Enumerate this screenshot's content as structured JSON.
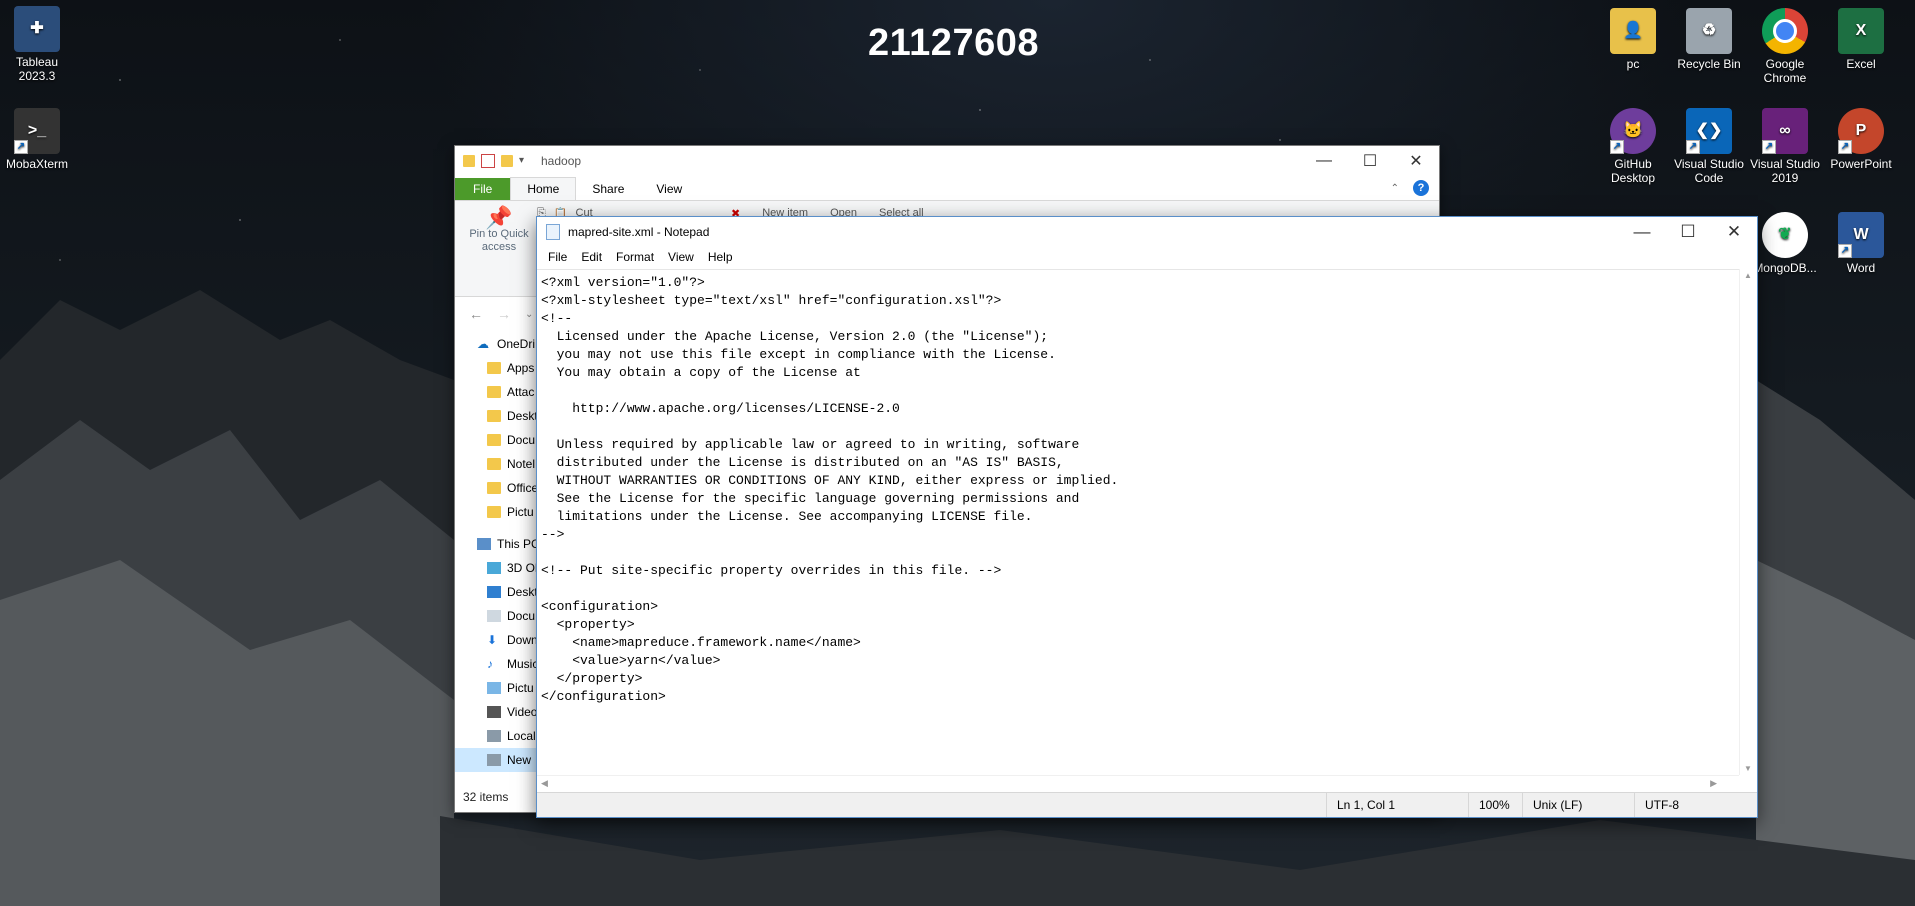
{
  "desktop": {
    "number": "21127608",
    "icons_left": [
      {
        "label": "Tableau 2023.3",
        "icon": "tableau-icon"
      },
      {
        "label": "MobaXterm",
        "icon": "mobaxterm-icon"
      }
    ],
    "icons_right": [
      {
        "label": "pc",
        "icon": "user-folder-icon"
      },
      {
        "label": "Recycle Bin",
        "icon": "recycle-bin-icon"
      },
      {
        "label": "Google Chrome",
        "icon": "chrome-icon"
      },
      {
        "label": "Excel",
        "icon": "excel-icon"
      },
      {
        "label": "GitHub Desktop",
        "icon": "github-icon"
      },
      {
        "label": "Visual Studio Code",
        "icon": "vscode-icon"
      },
      {
        "label": "Visual Studio 2019",
        "icon": "visual-studio-icon"
      },
      {
        "label": "PowerPoint",
        "icon": "powerpoint-icon"
      },
      {
        "label": "MongoDB...",
        "icon": "mongodb-icon"
      },
      {
        "label": "Word",
        "icon": "word-icon"
      }
    ]
  },
  "explorer": {
    "title": "hadoop",
    "tabs": [
      "File",
      "Home",
      "Share",
      "View"
    ],
    "ribbon": {
      "pin_label": "Pin to Quick access",
      "cut": "Cut",
      "new_item": "New item",
      "open": "Open",
      "select_all": "Select all"
    },
    "nav_items": [
      "OneDri",
      "Apps",
      "Attac",
      "Deskt",
      "Docu",
      "Notel",
      "Office",
      "Pictu",
      "This PC",
      "3D Ol",
      "Deskt",
      "Docu",
      "Down",
      "Music",
      "Pictu",
      "Video",
      "Local",
      "New"
    ],
    "status": "32 items"
  },
  "notepad": {
    "title": "mapred-site.xml - Notepad",
    "menu": [
      "File",
      "Edit",
      "Format",
      "View",
      "Help"
    ],
    "content": "<?xml version=\"1.0\"?>\n<?xml-stylesheet type=\"text/xsl\" href=\"configuration.xsl\"?>\n<!--\n  Licensed under the Apache License, Version 2.0 (the \"License\");\n  you may not use this file except in compliance with the License.\n  You may obtain a copy of the License at\n\n    http://www.apache.org/licenses/LICENSE-2.0\n\n  Unless required by applicable law or agreed to in writing, software\n  distributed under the License is distributed on an \"AS IS\" BASIS,\n  WITHOUT WARRANTIES OR CONDITIONS OF ANY KIND, either express or implied.\n  See the License for the specific language governing permissions and\n  limitations under the License. See accompanying LICENSE file.\n-->\n\n<!-- Put site-specific property overrides in this file. -->\n\n<configuration>\n  <property>\n    <name>mapreduce.framework.name</name>\n    <value>yarn</value>\n  </property>\n</configuration>",
    "status": {
      "position": "Ln 1, Col 1",
      "zoom": "100%",
      "line_ending": "Unix (LF)",
      "encoding": "UTF-8"
    }
  }
}
